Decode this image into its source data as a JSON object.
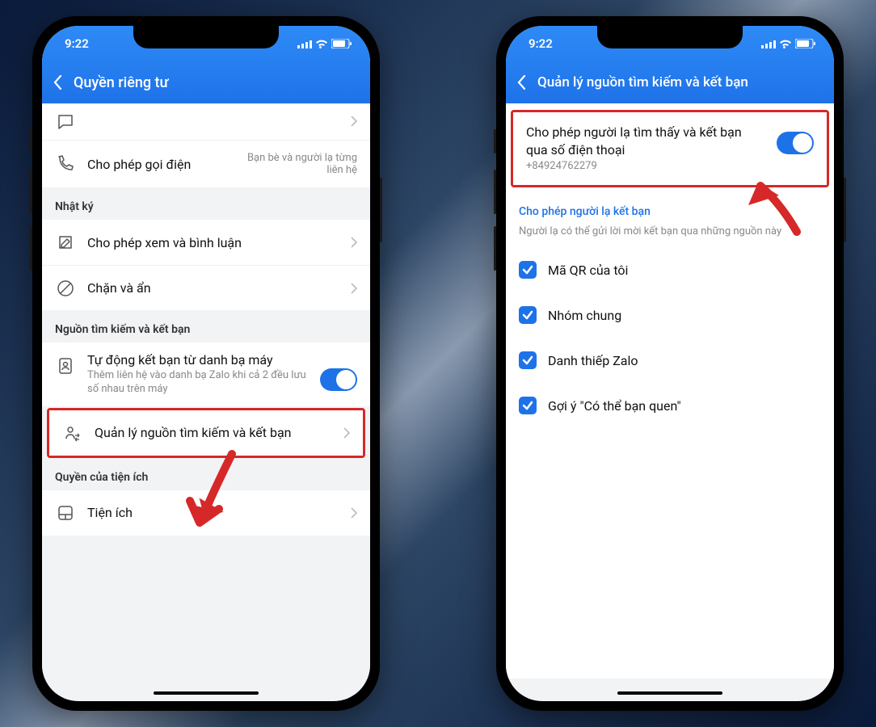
{
  "status": {
    "time": "9:22"
  },
  "phone1": {
    "nav_title": "Quyền riêng tư",
    "row_call_title": "Cho phép gọi điện",
    "row_call_side": "Bạn bè và người lạ từng liên hệ",
    "section_diary": "Nhật ký",
    "row_view_comment": "Cho phép xem và bình luận",
    "row_block_hide": "Chặn và ẩn",
    "section_sources": "Nguồn tìm kiếm và kết bạn",
    "row_auto_friend_title": "Tự động kết bạn từ danh bạ máy",
    "row_auto_friend_sub": "Thêm liên hệ vào danh bạ Zalo khi cả 2 đều lưu số nhau trên máy",
    "row_manage_sources": "Quản lý nguồn tìm kiếm và kết bạn",
    "section_ext": "Quyền của tiện ích",
    "row_ext": "Tiện ích"
  },
  "phone2": {
    "nav_title": "Quản lý nguồn tìm kiếm và kết bạn",
    "row_allow_find_title": "Cho phép người lạ tìm thấy và kết bạn qua số điện thoại",
    "row_allow_find_phone": "+84924762279",
    "section_allow_friend": "Cho phép người lạ kết bạn",
    "section_allow_friend_desc": "Người lạ có thể gửi lời mời kết bạn qua những nguồn này",
    "check_qr": "Mã QR của tôi",
    "check_group": "Nhóm chung",
    "check_card": "Danh thiếp Zalo",
    "check_suggest": "Gợi ý \"Có thể bạn quen\""
  }
}
